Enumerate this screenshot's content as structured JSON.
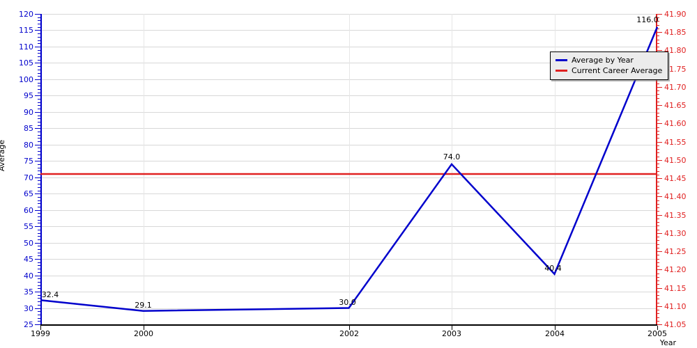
{
  "chart_data": {
    "type": "line",
    "title": "",
    "xlabel": "Year",
    "ylabel": "Average",
    "y2label": "",
    "grid": true,
    "legend_position": "top-right",
    "categories": [
      "1999",
      "2000",
      "2002",
      "2003",
      "2004",
      "2005"
    ],
    "x": [
      1999,
      2000,
      2002,
      2003,
      2004,
      2005
    ],
    "xlim": [
      1999,
      2005
    ],
    "ylim": [
      25,
      120
    ],
    "y2lim": [
      41.05,
      41.9
    ],
    "series": [
      {
        "name": "Average by Year",
        "color": "#0000cc",
        "axis": "left",
        "values": [
          32.4,
          29.1,
          30.0,
          74.0,
          40.4,
          116.0
        ],
        "point_labels": [
          "32.4",
          "29.1",
          "30.0",
          "74.0",
          "40.4",
          "116.0"
        ]
      },
      {
        "name": "Current Career Average",
        "color": "#e02020",
        "axis": "left",
        "type": "hline",
        "value": 71.0
      }
    ],
    "y_ticks": [
      25,
      30,
      35,
      40,
      45,
      50,
      55,
      60,
      65,
      70,
      75,
      80,
      85,
      90,
      95,
      100,
      105,
      110,
      115,
      120
    ],
    "y_tick_labels": [
      "25",
      "30",
      "35",
      "40",
      "45",
      "50",
      "55",
      "60",
      "65",
      "70",
      "75",
      "80",
      "85",
      "90",
      "95",
      "100",
      "105",
      "110",
      "115",
      "120"
    ],
    "y2_ticks": [
      41.05,
      41.1,
      41.15,
      41.2,
      41.25,
      41.3,
      41.35,
      41.4,
      41.45,
      41.5,
      41.55,
      41.6,
      41.65,
      41.7,
      41.75,
      41.8,
      41.85,
      41.9
    ],
    "y2_tick_labels": [
      "41.05",
      "41.10",
      "41.15",
      "41.20",
      "41.25",
      "41.30",
      "41.35",
      "41.40",
      "41.45",
      "41.50",
      "41.55",
      "41.60",
      "41.65",
      "41.70",
      "41.75",
      "41.80",
      "41.85",
      "41.90"
    ],
    "x_tick_labels": [
      "1999",
      "2000",
      "2002",
      "2003",
      "2004",
      "2005"
    ],
    "colors": {
      "left_axis": "#0000cc",
      "right_axis": "#e02020",
      "grid": "#d8d8d8",
      "background": "#ffffff",
      "legend_background": "#ececec"
    }
  },
  "legend": {
    "items": [
      {
        "label": "Average by Year",
        "color": "#0000cc"
      },
      {
        "label": "Current Career Average",
        "color": "#e02020"
      }
    ]
  },
  "axes": {
    "y_title": "Average",
    "x_title": "Year"
  }
}
